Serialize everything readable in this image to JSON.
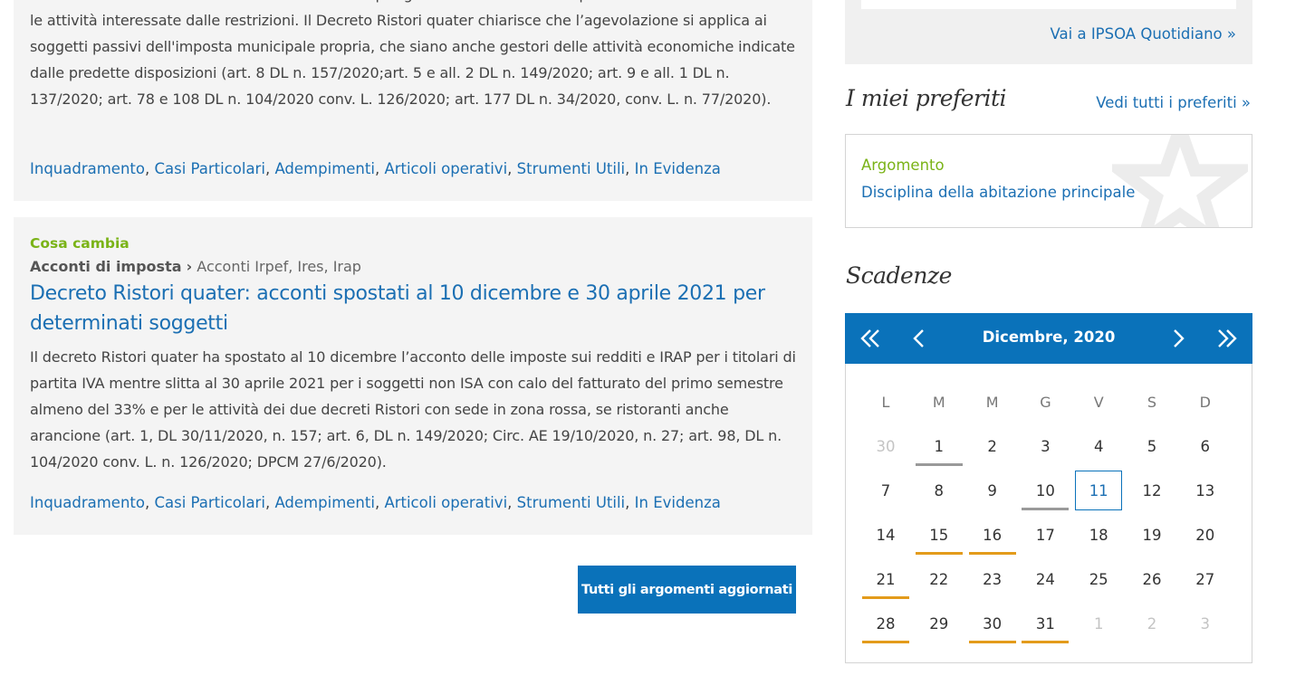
{
  "articles": [
    {
      "body": "l DL Ristori e Ristori-bis cancellano la II rata IMU per gli immobili e le relative pertinenze in cui si esercitano le attività interessate dalle restrizioni. Il Decreto Ristori quater chiarisce che l’agevolazione si applica ai soggetti passivi dell'imposta municipale propria, che siano anche gestori delle attività economiche indicate dalle predette disposizioni (art. 8 DL n. 157/2020;art. 5 e all. 2 DL n. 149/2020; art. 9 e all. 1 DL n. 137/2020; art. 78 e 108 DL n. 104/2020 conv. L. 126/2020; art. 177 DL n. 34/2020, conv. L. n. 77/2020).",
      "tags": [
        "Inquadramento",
        "Casi Particolari",
        "Adempimenti",
        "Articoli operativi",
        "Strumenti Utili",
        "In Evidenza"
      ]
    },
    {
      "category": "Cosa cambia",
      "crumb_main": "Acconti di imposta",
      "crumb_sep": "›",
      "crumb_sub": "Acconti Irpef, Ires, Irap",
      "title": "Decreto Ristori quater: acconti spostati al 10 dicembre e 30 aprile 2021 per determinati soggetti",
      "body": "Il decreto Ristori quater ha spostato al 10 dicembre l’acconto delle imposte sui redditi e IRAP per i titolari di partita IVA mentre slitta al 30 aprile 2021 per i soggetti non ISA con calo del fatturato del primo semestre almeno del 33% e per le attività dei due decreti Ristori con sede in zona rossa, se ristoranti anche arancione (art. 1, DL 30/11/2020, n. 157; art. 6, DL n. 149/2020; Circ. AE 19/10/2020, n. 27; art. 98, DL n. 104/2020 conv. L. n. 126/2020; DPCM 27/6/2020).",
      "tags": [
        "Inquadramento",
        "Casi Particolari",
        "Adempimenti",
        "Articoli operativi",
        "Strumenti Utili",
        "In Evidenza"
      ]
    }
  ],
  "all_topics_button": "Tutti gli argomenti aggiornati",
  "ipsoa_link": "Vai a IPSOA Quotidiano  »",
  "favorites": {
    "title": "I miei preferiti",
    "see_all": "Vedi tutti i preferiti  »",
    "label": "Argomento",
    "item": "Disciplina della abitazione principale"
  },
  "deadlines": {
    "title": "Scadenze",
    "month": "Dicembre, 2020",
    "weekdays": [
      "L",
      "M",
      "M",
      "G",
      "V",
      "S",
      "D"
    ],
    "weeks": [
      [
        {
          "d": "30",
          "m": true
        },
        {
          "d": "1",
          "mark": "gray"
        },
        {
          "d": "2"
        },
        {
          "d": "3"
        },
        {
          "d": "4"
        },
        {
          "d": "5"
        },
        {
          "d": "6"
        }
      ],
      [
        {
          "d": "7"
        },
        {
          "d": "8"
        },
        {
          "d": "9"
        },
        {
          "d": "10",
          "mark": "gray"
        },
        {
          "d": "11",
          "today": true
        },
        {
          "d": "12"
        },
        {
          "d": "13"
        }
      ],
      [
        {
          "d": "14"
        },
        {
          "d": "15",
          "mark": "orange"
        },
        {
          "d": "16",
          "mark": "orange"
        },
        {
          "d": "17"
        },
        {
          "d": "18"
        },
        {
          "d": "19"
        },
        {
          "d": "20"
        }
      ],
      [
        {
          "d": "21",
          "mark": "orange"
        },
        {
          "d": "22"
        },
        {
          "d": "23"
        },
        {
          "d": "24"
        },
        {
          "d": "25"
        },
        {
          "d": "26"
        },
        {
          "d": "27"
        }
      ],
      [
        {
          "d": "28",
          "mark": "orange"
        },
        {
          "d": "29"
        },
        {
          "d": "30",
          "mark": "orange"
        },
        {
          "d": "31",
          "mark": "orange"
        },
        {
          "d": "1",
          "m": true
        },
        {
          "d": "2",
          "m": true
        },
        {
          "d": "3",
          "m": true
        }
      ]
    ],
    "colors": {
      "gray": "#9a9a9a",
      "orange": "#e39b1b",
      "accent": "#0a72ba"
    }
  }
}
